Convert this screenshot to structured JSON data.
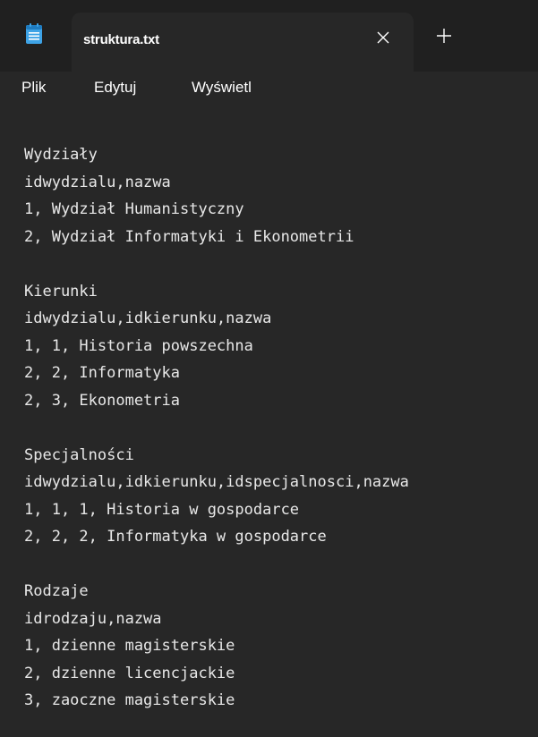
{
  "tab": {
    "title": "struktura.txt",
    "close_icon": "close-icon",
    "new_tab_icon": "plus-icon"
  },
  "app_icon": "notepad-icon",
  "menu": {
    "file": "Plik",
    "edit": "Edytuj",
    "view": "Wyświetl"
  },
  "editor": {
    "lines": [
      "Wydziały",
      "idwydzialu,nazwa",
      "1, Wydział Humanistyczny",
      "2, Wydział Informatyki i Ekonometrii",
      "",
      "Kierunki",
      "idwydzialu,idkierunku,nazwa",
      "1, 1, Historia powszechna",
      "2, 2, Informatyka",
      "2, 3, Ekonometria",
      "",
      "Specjalności",
      "idwydzialu,idkierunku,idspecjalnosci,nazwa",
      "1, 1, 1, Historia w gospodarce",
      "2, 2, 2, Informatyka w gospodarce",
      "",
      "Rodzaje",
      "idrodzaju,nazwa",
      "1, dzienne magisterskie",
      "2, dzienne licencjackie",
      "3, zaoczne magisterskie"
    ]
  },
  "colors": {
    "accent_icon": "#3ea3e6",
    "background": "#272727",
    "tabbar": "#202020",
    "text": "#e8e8e8"
  }
}
